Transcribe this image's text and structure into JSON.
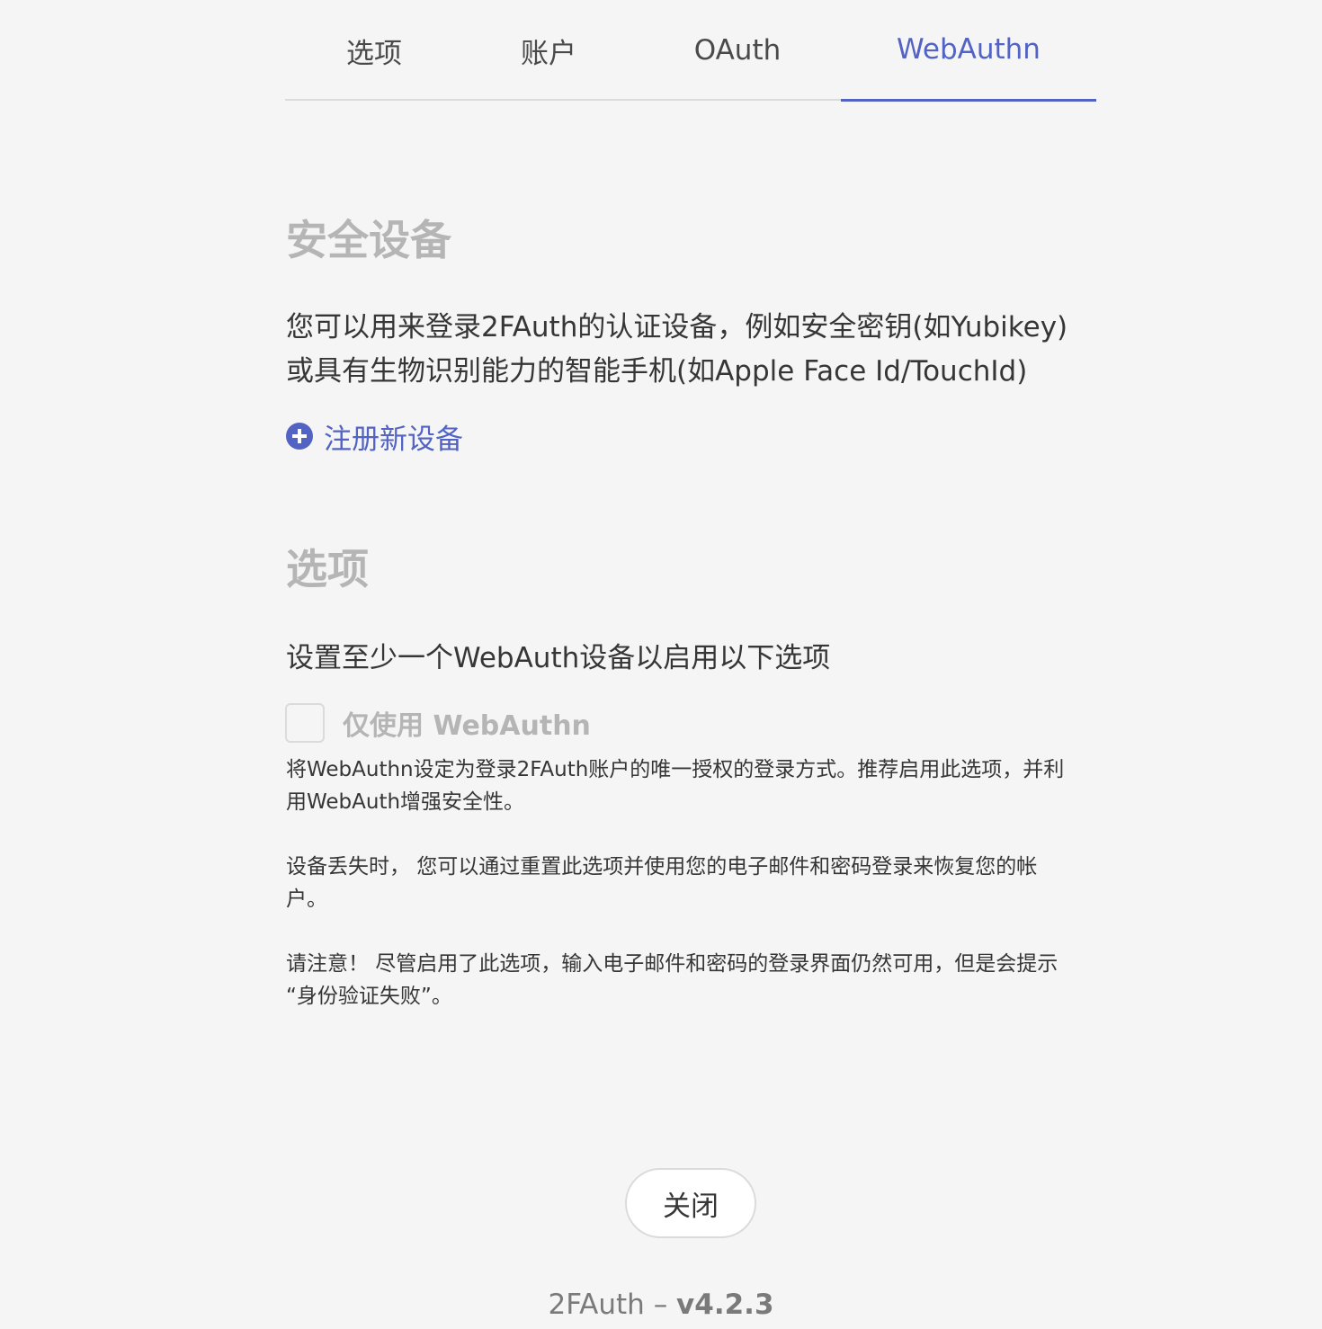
{
  "tabs": [
    {
      "label": "选项",
      "active": false
    },
    {
      "label": "账户",
      "active": false
    },
    {
      "label": "OAuth",
      "active": false
    },
    {
      "label": "WebAuthn",
      "active": true
    }
  ],
  "security": {
    "heading": "安全设备",
    "description_line1": "您可以用来登录2FAuth的认证设备，例如安全密钥(如Yubikey)",
    "description_line2": "或具有生物识别能力的智能手机(如Apple Face Id/TouchId)",
    "register_label": "注册新设备",
    "register_icon": "plus-circle-icon"
  },
  "options": {
    "heading": "选项",
    "hint": "设置至少一个WebAuth设备以启用以下选项",
    "checkbox_label": "仅使用 WebAuthn",
    "checkbox_checked": false,
    "help1_line1": "将WebAuthn设定为登录2FAuth账户的唯一授权的登录方式。推荐启用此选项，并利",
    "help1_line2": "用WebAuth增强安全性。",
    "help2_line1": "设备丢失时， 您可以通过重置此选项并使用您的电子邮件和密码登录来恢复您的帐",
    "help2_line2": "户。",
    "help3_line1": "请注意！ 尽管启用了此选项，输入电子邮件和密码的登录界面仍然可用，但是会提示",
    "help3_line2": "“身份验证失败”。"
  },
  "close_label": "关闭",
  "footer": {
    "app": "2FAuth –",
    "version": "v4.2.3"
  },
  "colors": {
    "accent": "#5363c3",
    "background": "#f5f5f5",
    "muted": "#b5b5b5"
  }
}
